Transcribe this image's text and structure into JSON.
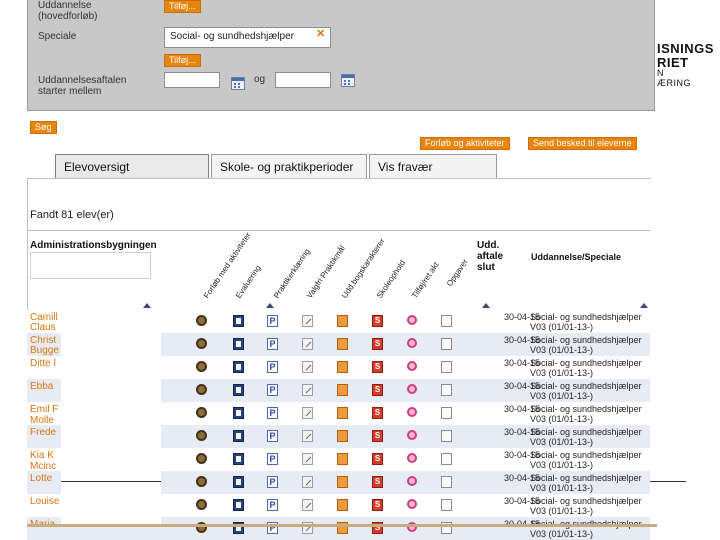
{
  "filter": {
    "uddannelse_label_1": "Uddannelse",
    "uddannelse_label_2": "(hovedforløb)",
    "tilfoej_label": "Tilføj...",
    "speciale_label": "Speciale",
    "speciale_value": "Social- og sundhedshjælper",
    "remove_symbol": "✕",
    "aftale_label_1": "Uddannelsesaftalen",
    "aftale_label_2": "starter mellem",
    "og_label": "og",
    "date_from": "",
    "date_to": ""
  },
  "brand": {
    "line1": "ISNINGS",
    "line2": "RIET",
    "line3": "N",
    "line4": "ÆRING"
  },
  "toolbar": {
    "search_label": "Søg",
    "forloeb_label": "Forløb og aktiviteter",
    "send_label": "Send besked til eleverne"
  },
  "tabs": [
    {
      "label": "Elevoversigt",
      "active": true
    },
    {
      "label": "Skole- og praktikperioder",
      "active": false
    },
    {
      "label": "Vis fravær",
      "active": false
    }
  ],
  "result_text": "Fandt 81 elev(er)",
  "table": {
    "group_header": "Administrationsbygningen",
    "rotated_headers": [
      "Forløb med aktiviteter",
      "Evaluering",
      "Praktikerklæring",
      "Valgfri Praktikmål",
      "Udd.bogskarakterer",
      "Skoleophold",
      "Tilføj/ret akt",
      "Opgaver"
    ],
    "udd_slut_header": [
      "Udd.",
      "aftale",
      "slut"
    ],
    "speciale_header": "Uddannelse/Speciale",
    "icon_columns": [
      "gear-icon",
      "evaluation-icon",
      "p-doc-icon",
      "pencil-icon",
      "book-icon",
      "s-icon",
      "bulb-icon",
      "document-icon"
    ],
    "rows": [
      {
        "name": "Camill",
        "date": "30-04-15",
        "spec1": "Social- og sundhedshjælper",
        "spec2": "V03 (01/01-13-)"
      },
      {
        "name": "Christ",
        "date": "30-04-15",
        "spec1": "Social- og sundhedshjælper",
        "spec2": "V03 (01/01-13-)"
      },
      {
        "name": "Ditte I",
        "date": "30-04-15",
        "spec1": "Social- og sundhedshjælper",
        "spec2": "V03 (01/01-13-)"
      },
      {
        "name": "Ebba",
        "date": "30-04-15",
        "spec1": "Social- og sundhedshjælper",
        "spec2": "V03 (01/01-13-)"
      },
      {
        "name": "Emil F",
        "date": "30-04-15",
        "spec1": "Social- og sundhedshjælper",
        "spec2": "V03 (01/01-13-)"
      },
      {
        "name": "Frede",
        "date": "30-04-15",
        "spec1": "Social- og sundhedshjælper",
        "spec2": "V03 (01/01-13-)"
      },
      {
        "name": "Kia K",
        "date": "30-04-15",
        "spec1": "Social- og sundhedshjælper",
        "spec2": "V03 (01/01-13-)"
      },
      {
        "name": "Lotte",
        "date": "30-04-15",
        "spec1": "Social- og sundhedshjælper",
        "spec2": "V03 (01/01-13-)"
      },
      {
        "name": "Louise",
        "date": "30-04-15",
        "spec1": "Social- og sundhedshjælper",
        "spec2": "V03 (01/01-13-)"
      },
      {
        "name": "Maria",
        "date": "30-04-15",
        "spec1": "Social- og sundhedshjælper",
        "spec2": "V03 (01/01-13-)"
      }
    ],
    "extra_names": [
      "Claus",
      "Bugge",
      "Molle",
      "Mcinc"
    ]
  }
}
